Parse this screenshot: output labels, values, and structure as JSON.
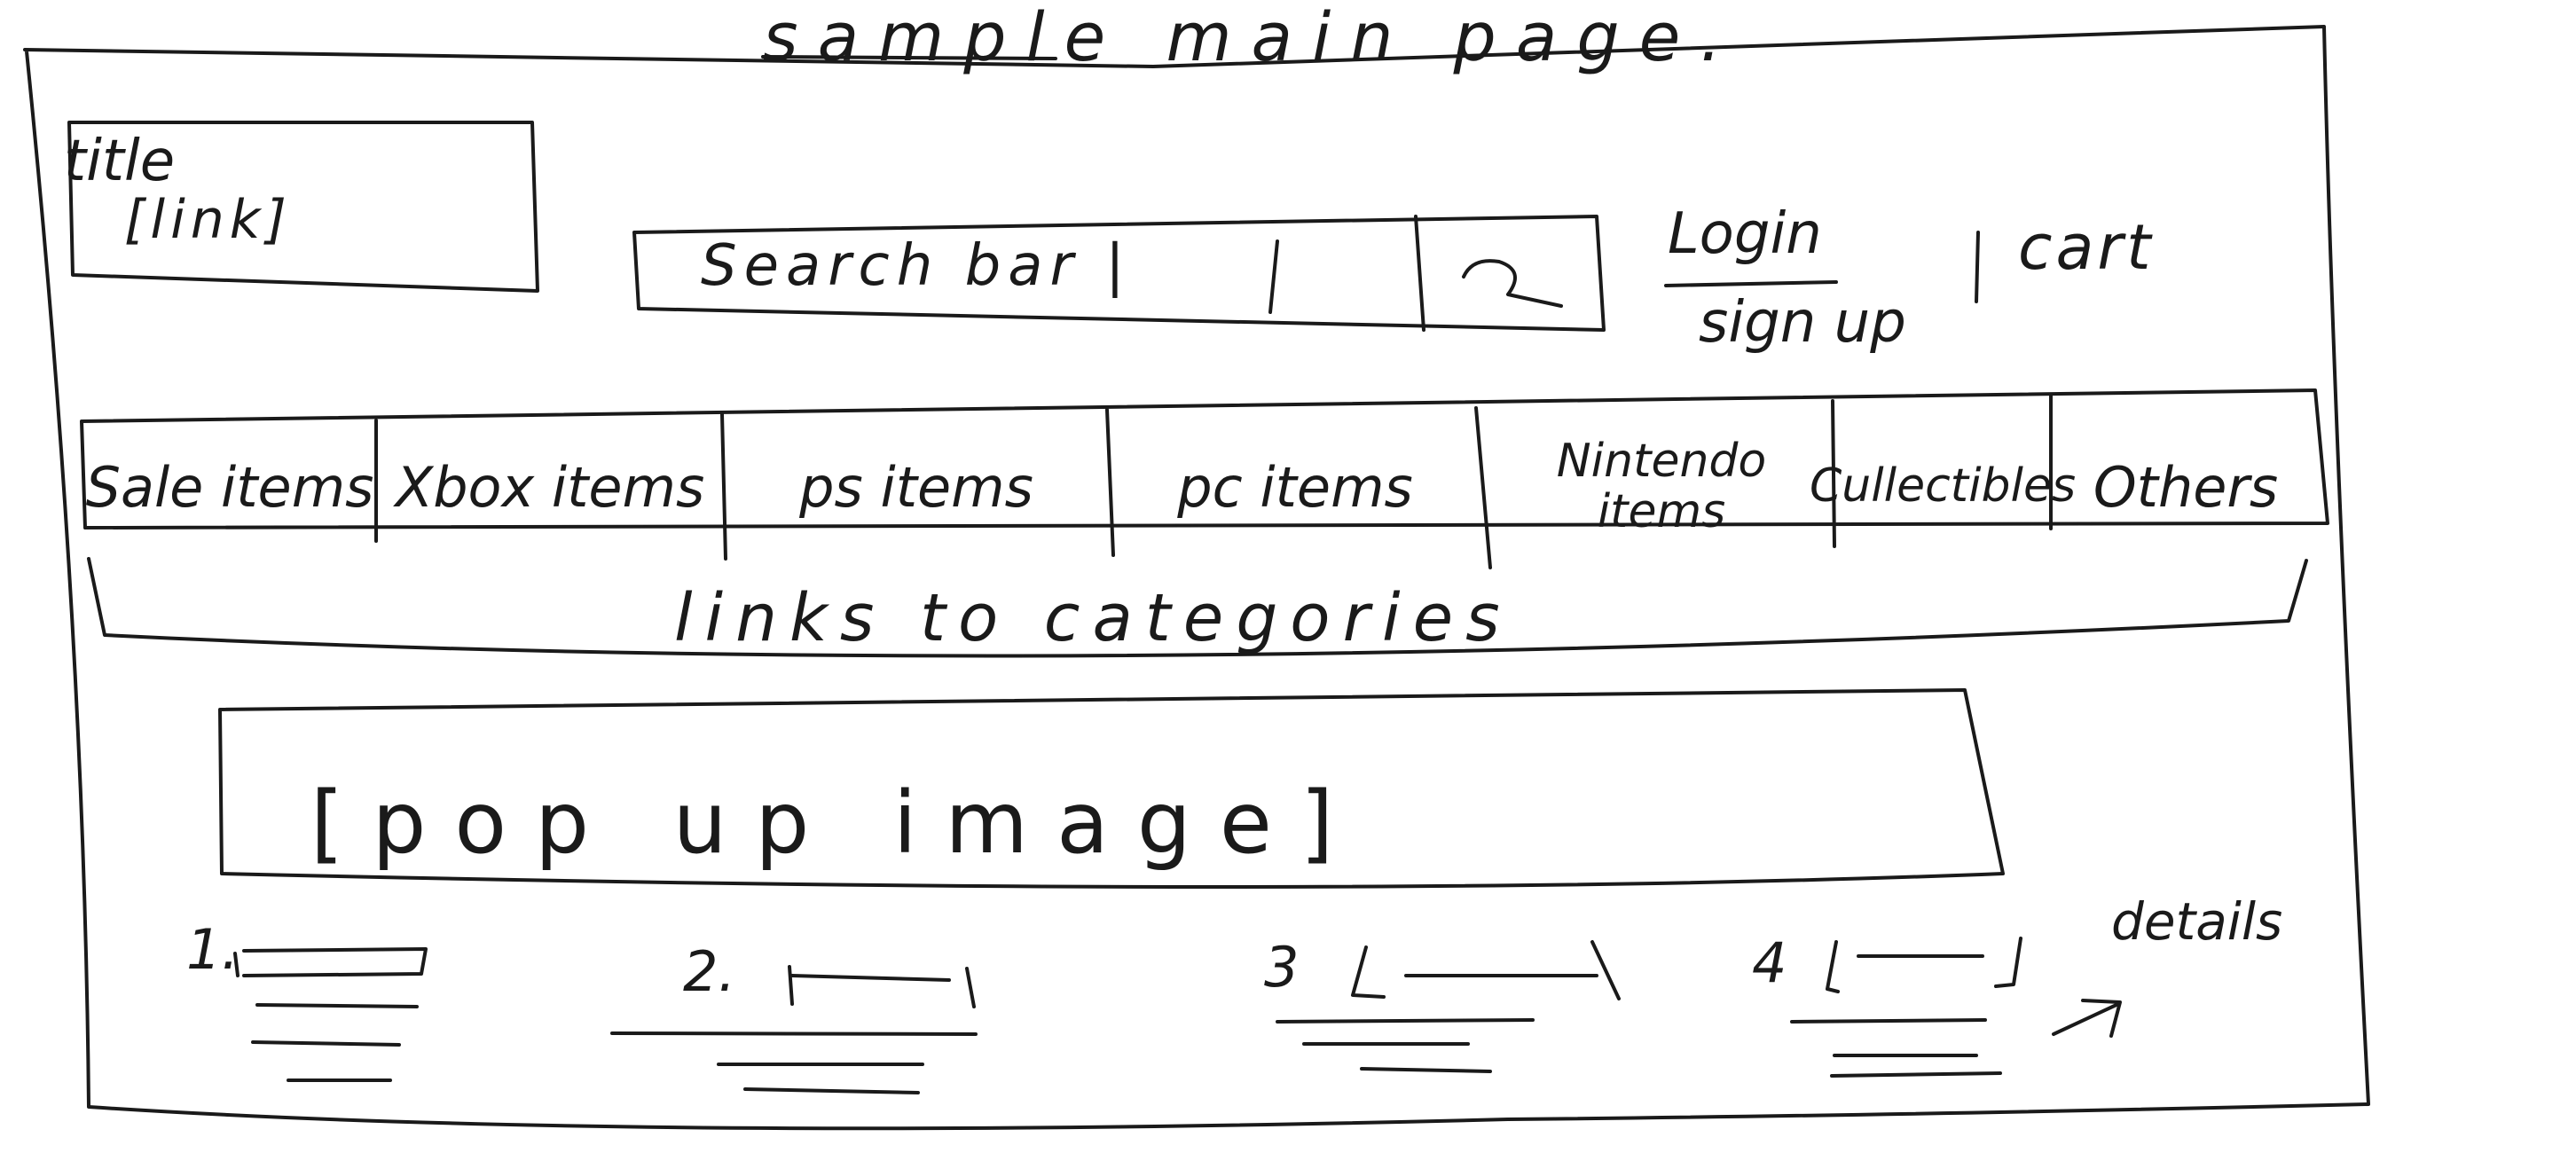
{
  "page": {
    "title": "sample main page."
  },
  "header": {
    "title_box": {
      "line1": "title",
      "line2": "[link]"
    },
    "search": {
      "text": "Search bar |",
      "button_icon": "search-icon"
    },
    "login": "Login",
    "signup": "sign up",
    "separator": "|",
    "cart": "cart"
  },
  "nav": {
    "tabs": [
      {
        "label": "Sale items"
      },
      {
        "label": "Xbox items"
      },
      {
        "label": "ps items"
      },
      {
        "label": "pc items"
      },
      {
        "label": "Nintendo items"
      },
      {
        "label": "Cullectibles"
      },
      {
        "label": "Others"
      }
    ],
    "caption": "links to categories"
  },
  "banner": {
    "label": "[pop up image]"
  },
  "products": {
    "items": [
      {
        "number": "1."
      },
      {
        "number": "2."
      },
      {
        "number": "3"
      },
      {
        "number": "4"
      }
    ],
    "details": "details"
  }
}
